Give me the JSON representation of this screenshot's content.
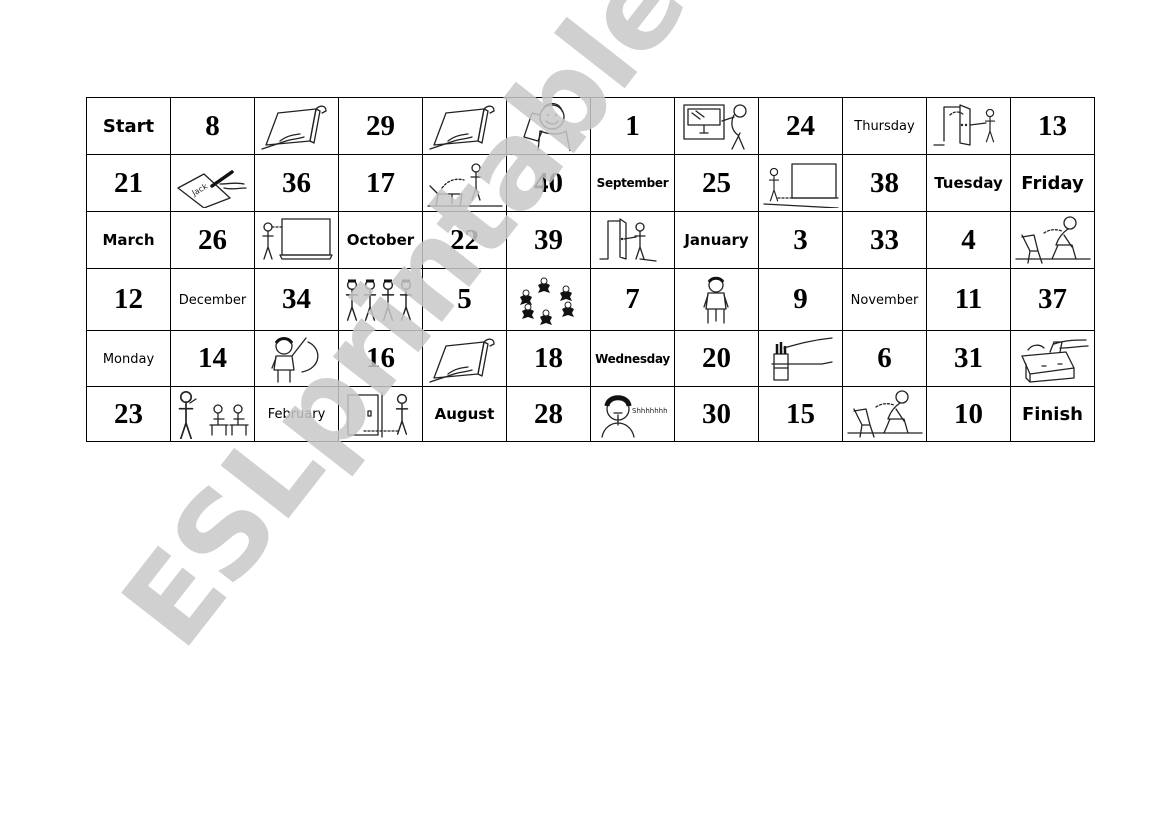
{
  "document": {
    "type": "board-game-worksheet",
    "watermark": "ESLprintables.com",
    "colors": {
      "border": "#000000",
      "text": "#000000",
      "watermark": "#c8c8c8",
      "background": "#ffffff"
    }
  },
  "board": {
    "rows": [
      [
        {
          "kind": "word",
          "text": "Start",
          "size": "big"
        },
        {
          "kind": "number",
          "text": "8"
        },
        {
          "kind": "picture",
          "icon": "open-book-icon",
          "action": "open your book"
        },
        {
          "kind": "number",
          "text": "29"
        },
        {
          "kind": "picture",
          "icon": "open-book-icon",
          "action": "open your book"
        },
        {
          "kind": "picture",
          "icon": "boy-listening-icon",
          "action": "listen"
        },
        {
          "kind": "number",
          "text": "1"
        },
        {
          "kind": "picture",
          "icon": "open-window-icon",
          "action": "open the window"
        },
        {
          "kind": "number",
          "text": "24"
        },
        {
          "kind": "word",
          "text": "Thursday",
          "size": "sm"
        },
        {
          "kind": "picture",
          "icon": "open-door-icon",
          "action": "open the door"
        },
        {
          "kind": "number",
          "text": "13"
        }
      ],
      [
        {
          "kind": "number",
          "text": "21"
        },
        {
          "kind": "picture",
          "icon": "write-name-icon",
          "action": "write your name",
          "label": "Jack"
        },
        {
          "kind": "number",
          "text": "36"
        },
        {
          "kind": "number",
          "text": "17"
        },
        {
          "kind": "picture",
          "icon": "stand-up-icon",
          "action": "stand up"
        },
        {
          "kind": "number",
          "text": "40"
        },
        {
          "kind": "word",
          "text": "September",
          "size": "xs"
        },
        {
          "kind": "number",
          "text": "25"
        },
        {
          "kind": "picture",
          "icon": "go-to-board-icon",
          "action": "go to the board"
        },
        {
          "kind": "number",
          "text": "38"
        },
        {
          "kind": "word",
          "text": "Tuesday",
          "size": "mid"
        },
        {
          "kind": "word",
          "text": "Friday",
          "size": "big"
        }
      ],
      [
        {
          "kind": "word",
          "text": "March",
          "size": "mid"
        },
        {
          "kind": "number",
          "text": "26"
        },
        {
          "kind": "picture",
          "icon": "look-at-board-icon",
          "action": "look at the board"
        },
        {
          "kind": "word",
          "text": "October",
          "size": "mid"
        },
        {
          "kind": "number",
          "text": "22"
        },
        {
          "kind": "number",
          "text": "39"
        },
        {
          "kind": "picture",
          "icon": "close-door-icon",
          "action": "close the door"
        },
        {
          "kind": "word",
          "text": "January",
          "size": "mid"
        },
        {
          "kind": "number",
          "text": "3"
        },
        {
          "kind": "number",
          "text": "33"
        },
        {
          "kind": "number",
          "text": "4"
        },
        {
          "kind": "picture",
          "icon": "sit-down-icon",
          "action": "sit down"
        }
      ],
      [
        {
          "kind": "number",
          "text": "12"
        },
        {
          "kind": "word",
          "text": "December",
          "size": "sm"
        },
        {
          "kind": "number",
          "text": "34"
        },
        {
          "kind": "picture",
          "icon": "line-up-icon",
          "action": "line up"
        },
        {
          "kind": "number",
          "text": "5"
        },
        {
          "kind": "picture",
          "icon": "make-a-circle-icon",
          "action": "make a circle"
        },
        {
          "kind": "number",
          "text": "7"
        },
        {
          "kind": "picture",
          "icon": "stand-still-icon",
          "action": "stand still"
        },
        {
          "kind": "number",
          "text": "9"
        },
        {
          "kind": "word",
          "text": "November",
          "size": "sm"
        },
        {
          "kind": "number",
          "text": "11"
        },
        {
          "kind": "number",
          "text": "37"
        }
      ],
      [
        {
          "kind": "word",
          "text": "Monday",
          "size": "sm"
        },
        {
          "kind": "number",
          "text": "14"
        },
        {
          "kind": "picture",
          "icon": "raise-hand-icon",
          "action": "raise your hand"
        },
        {
          "kind": "number",
          "text": "16"
        },
        {
          "kind": "picture",
          "icon": "open-book-icon",
          "action": "open your book"
        },
        {
          "kind": "number",
          "text": "18"
        },
        {
          "kind": "word",
          "text": "Wednesday",
          "size": "xs"
        },
        {
          "kind": "number",
          "text": "20"
        },
        {
          "kind": "picture",
          "icon": "take-pencil-icon",
          "action": "take out a pencil"
        },
        {
          "kind": "number",
          "text": "6"
        },
        {
          "kind": "number",
          "text": "31"
        },
        {
          "kind": "picture",
          "icon": "open-bag-icon",
          "action": "open your bag"
        }
      ],
      [
        {
          "kind": "number",
          "text": "23"
        },
        {
          "kind": "picture",
          "icon": "teacher-students-icon",
          "action": "listen to the teacher"
        },
        {
          "kind": "word",
          "text": "February",
          "size": "sm"
        },
        {
          "kind": "picture",
          "icon": "go-out-door-icon",
          "action": "go out"
        },
        {
          "kind": "word",
          "text": "August",
          "size": "mid"
        },
        {
          "kind": "number",
          "text": "28"
        },
        {
          "kind": "picture",
          "icon": "be-quiet-icon",
          "action": "be quiet",
          "label": "Shhhhhhh"
        },
        {
          "kind": "number",
          "text": "30"
        },
        {
          "kind": "number",
          "text": "15"
        },
        {
          "kind": "picture",
          "icon": "sit-down-icon",
          "action": "sit down"
        },
        {
          "kind": "number",
          "text": "10"
        },
        {
          "kind": "word",
          "text": "Finish",
          "size": "big"
        }
      ]
    ]
  }
}
